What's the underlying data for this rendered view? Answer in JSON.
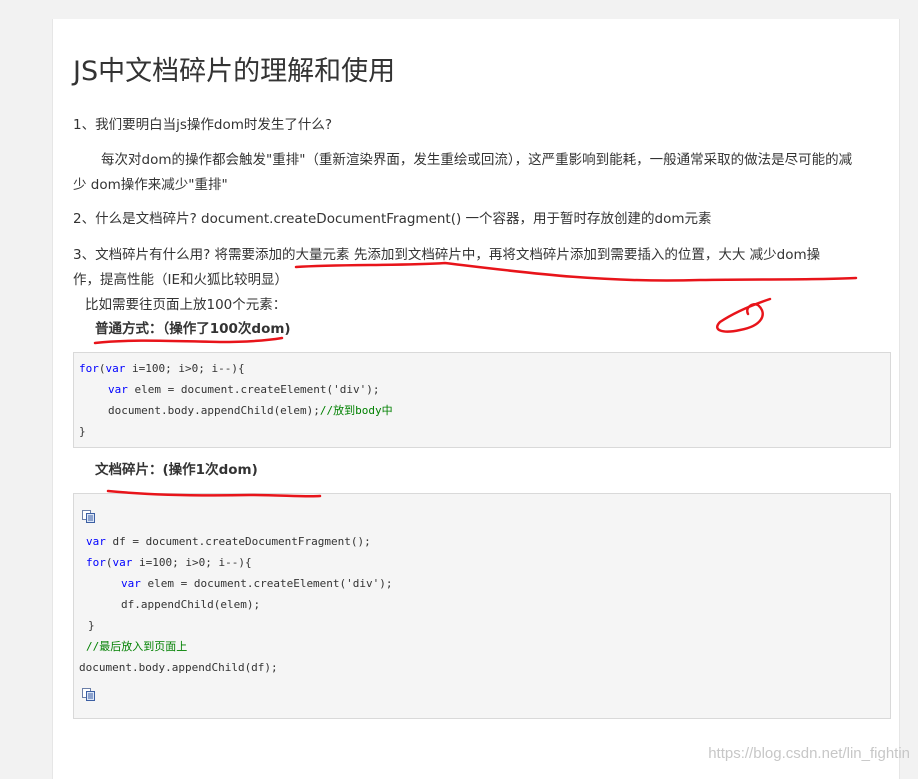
{
  "article": {
    "title": "JS中文档碎片的理解和使用",
    "q1": "1、我们要明白当js操作dom时发生了什么?",
    "p1_line1": "每次对dom的操作都会触发\"重排\"（重新渲染界面，发生重绘或回流），这严重影响到能耗，一般通常采取的做法是尽可能的减",
    "p1_line2": "少 dom操作来减少\"重排\"",
    "q2": "2、什么是文档碎片?      document.createDocumentFragment()    一个容器，用于暂时存放创建的dom元素",
    "q3_line1": "3、文档碎片有什么用?      将需要添加的大量元素  先添加到文档碎片中，再将文档碎片添加到需要插入的位置，大大 减少dom操",
    "q3_line2": "作，提高性能（IE和火狐比较明显）",
    "example_intro": "比如需要往页面上放100个元素：",
    "normal_heading": "普通方式：（操作了100次dom)",
    "fragment_heading": "文档碎片：(操作1次dom)"
  },
  "code1": {
    "l1_kw1": "for",
    "l1_a": "(",
    "l1_kw2": "var",
    "l1_b": " i=100; i>0; i--){",
    "l2_kw": "var",
    "l2_rest": " elem = document.createElement('div');",
    "l3_code": "document.body.appendChild(elem);",
    "l3_comment": "//放到body中",
    "l4": "}"
  },
  "code2": {
    "l1_kw": "var",
    "l1_rest": " df = document.createDocumentFragment();",
    "l2_kw1": "for",
    "l2_a": "(",
    "l2_kw2": "var",
    "l2_b": " i=100; i>0; i--){",
    "l3_kw": "var",
    "l3_rest": " elem = document.createElement('div');",
    "l4": "df.appendChild(elem);",
    "l5": "}",
    "l6_comment": "//最后放入到页面上",
    "l7": "document.body.appendChild(df);"
  },
  "icons": {
    "copy": "copy-code-icon"
  },
  "colors": {
    "annotation_red": "#e8141a",
    "keyword": "#0000ff",
    "comment": "#008000"
  },
  "watermark": "https://blog.csdn.net/lin_fightin"
}
